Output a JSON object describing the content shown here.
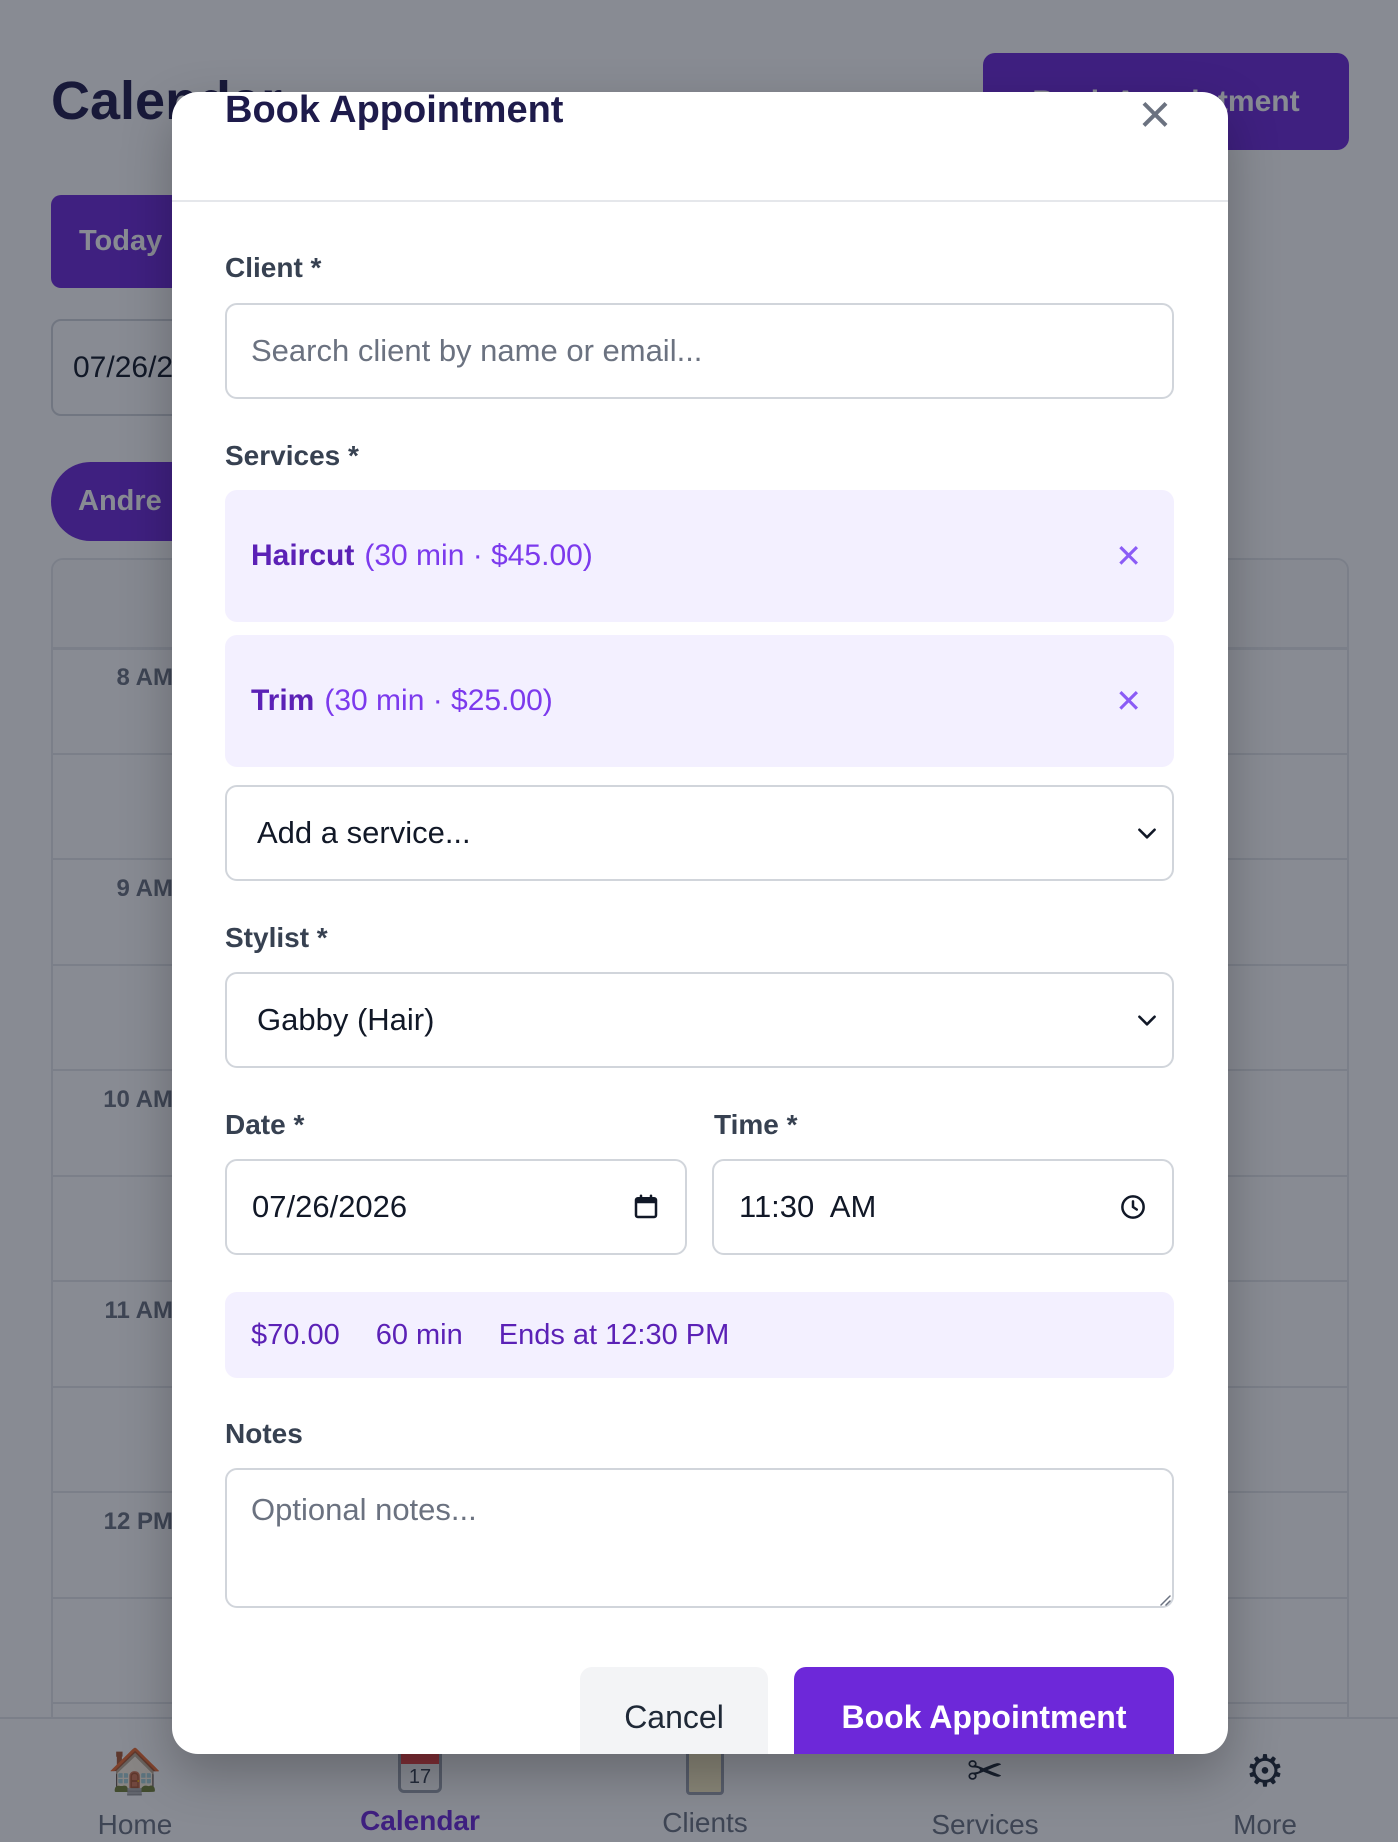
{
  "background": {
    "page_title": "Calendar",
    "book_button": "Book Appointment",
    "today_button": "Today",
    "date_value": "07/26/2026",
    "stylist_pill": "Andre",
    "hours": [
      "8 AM",
      "9 AM",
      "10 AM",
      "11 AM",
      "12 PM"
    ],
    "nav": [
      {
        "label": "Home",
        "icon": "home-icon"
      },
      {
        "label": "Calendar",
        "icon": "calendar-icon",
        "active": true,
        "day": "17"
      },
      {
        "label": "Clients",
        "icon": "clipboard-icon"
      },
      {
        "label": "Services",
        "icon": "scissors-icon"
      },
      {
        "label": "More",
        "icon": "gear-icon"
      }
    ]
  },
  "modal": {
    "title": "Book Appointment",
    "client": {
      "label": "Client *",
      "placeholder": "Search client by name or email..."
    },
    "services": {
      "label": "Services *",
      "selected": [
        {
          "name": "Haircut",
          "meta": "(30 min · $45.00)"
        },
        {
          "name": "Trim",
          "meta": "(30 min · $25.00)"
        }
      ],
      "add_placeholder": "Add a service..."
    },
    "stylist": {
      "label": "Stylist *",
      "value": "Gabby (Hair)"
    },
    "date": {
      "label": "Date *",
      "value": "07/26/2026"
    },
    "time": {
      "label": "Time *",
      "value": "11:30  AM"
    },
    "summary": {
      "price": "$70.00",
      "duration": "60 min",
      "ends": "Ends at 12:30 PM"
    },
    "notes": {
      "label": "Notes",
      "placeholder": "Optional notes..."
    },
    "cancel_label": "Cancel",
    "submit_label": "Book Appointment"
  },
  "colors": {
    "accent": "#6d28d9",
    "chip_bg": "#f3f0ff"
  }
}
